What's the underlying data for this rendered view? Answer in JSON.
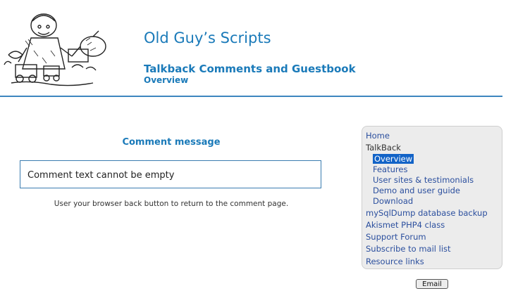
{
  "header": {
    "site_title": "Old Guy’s Scripts",
    "section_title": "Talkback Comments and Guestbook",
    "page_subtitle": "Overview"
  },
  "message": {
    "heading": "Comment message",
    "error_text": "Comment text cannot be empty",
    "hint": "User your browser back button to return to the comment page."
  },
  "sidebar": {
    "items": [
      {
        "label": "Home"
      },
      {
        "label": "TalkBack"
      },
      {
        "label": "Overview"
      },
      {
        "label": "Features"
      },
      {
        "label": "User sites & testimonials"
      },
      {
        "label": "Demo and user guide"
      },
      {
        "label": "Download"
      },
      {
        "label": "mySqlDump database backup"
      },
      {
        "label": "Akismet PHP4 class"
      },
      {
        "label": "Support Forum"
      },
      {
        "label": "Subscribe to mail list"
      },
      {
        "label": "Resource links"
      }
    ]
  },
  "footer": {
    "email_label": "Email"
  },
  "colors": {
    "title": "#1a7ab9",
    "rule": "#3d86bf",
    "nav_link": "#2b4f9e",
    "active_bg": "#1263c7"
  }
}
